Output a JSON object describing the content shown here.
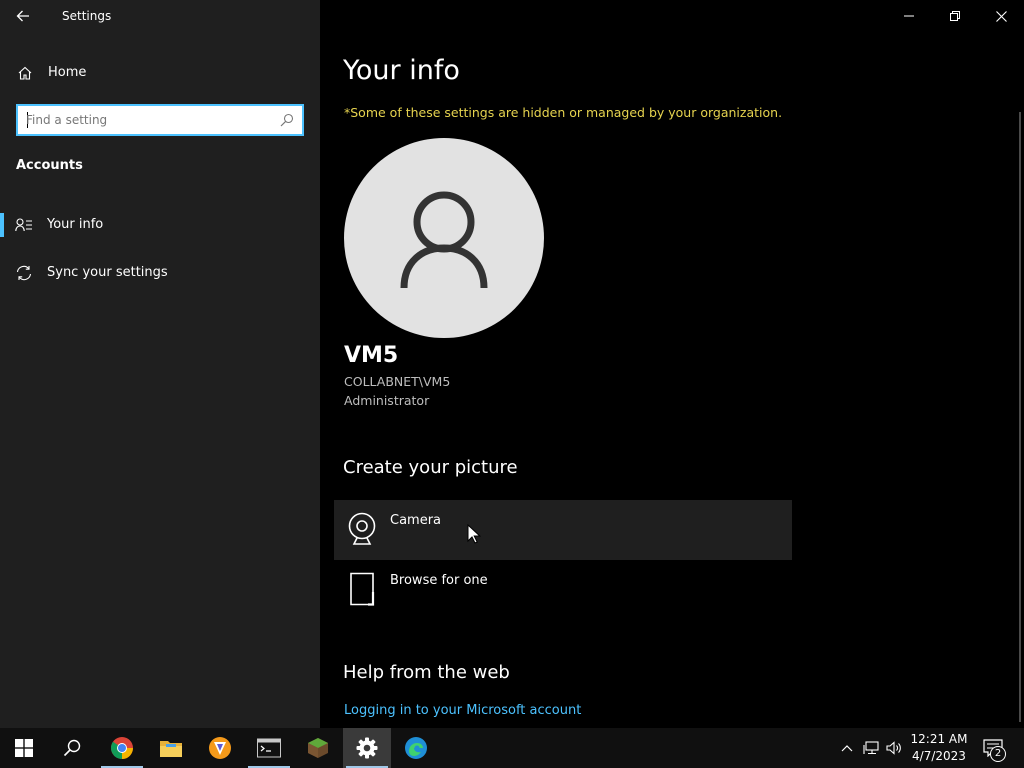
{
  "window": {
    "title": "Settings",
    "controls": [
      "minimize",
      "restore",
      "close"
    ]
  },
  "sidebar": {
    "home_label": "Home",
    "search_placeholder": "Find a setting",
    "section": "Accounts",
    "items": [
      {
        "label": "Your info",
        "icon": "contact-info-icon",
        "active": true
      },
      {
        "label": "Sync your settings",
        "icon": "sync-icon",
        "active": false
      }
    ]
  },
  "main": {
    "title": "Your info",
    "notice": "*Some of these settings are hidden or managed by your organization.",
    "user": {
      "name": "VM5",
      "domain": "COLLABNET\\VM5",
      "role": "Administrator"
    },
    "create_picture": {
      "heading": "Create your picture",
      "options": [
        {
          "label": "Camera",
          "icon": "camera-icon"
        },
        {
          "label": "Browse for one",
          "icon": "browse-file-icon"
        }
      ]
    },
    "help": {
      "heading": "Help from the web",
      "link": "Logging in to your Microsoft account"
    }
  },
  "taskbar": {
    "apps": [
      "start",
      "search",
      "chrome",
      "file-explorer",
      "brave",
      "terminal",
      "minecraft",
      "settings",
      "edge"
    ],
    "active_app": "settings",
    "clock": {
      "time": "12:21 AM",
      "date": "4/7/2023"
    },
    "notification_count": "2"
  },
  "colors": {
    "accent": "#4cc2ff",
    "notice": "#e6d34f",
    "sidebar_bg": "#1f1f1f",
    "content_bg": "#000000"
  }
}
